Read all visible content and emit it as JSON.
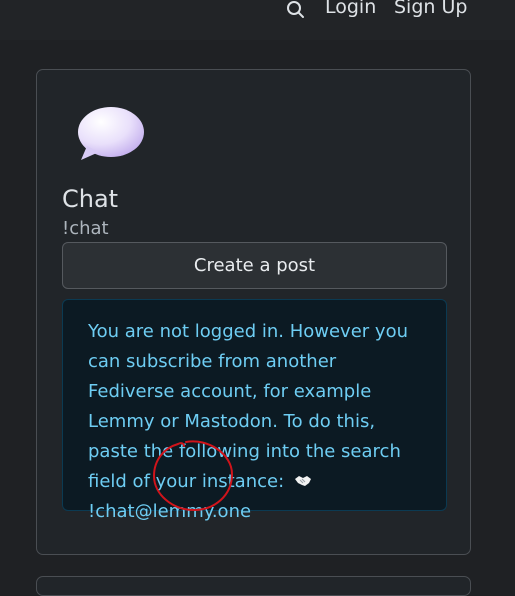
{
  "nav": {
    "search_icon": "search-icon",
    "login": "Login",
    "signup": "Sign Up"
  },
  "community": {
    "icon": "speech-bubble-icon",
    "name": "Chat",
    "handle": "!chat",
    "create_post": "Create a post"
  },
  "notice": {
    "text": "You are not logged in. However you can subscribe from another Fediverse account, for example Lemmy or Mastodon. To do this, paste the following into the search field of your instance:",
    "icon": "handshake-icon",
    "address": "!chat@lemmy.one"
  },
  "colors": {
    "background": "#1f2124",
    "card": "#212529",
    "info_text": "#6ecdf3",
    "annotation": "#d0141b"
  }
}
